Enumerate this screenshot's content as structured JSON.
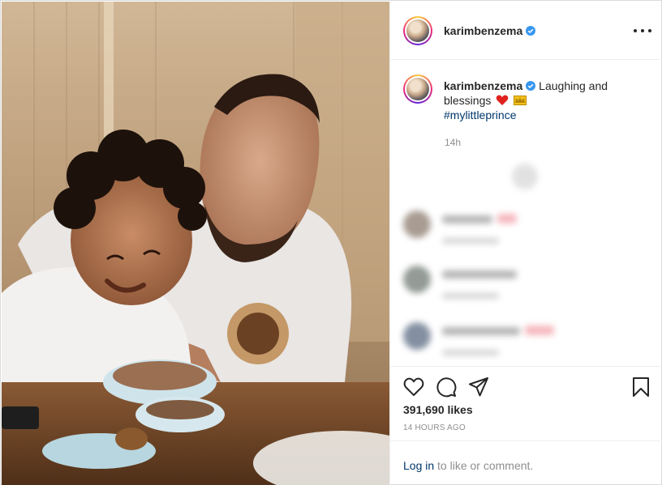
{
  "post": {
    "username": "karimbenzema",
    "caption_text": "Laughing and blessings",
    "hashtag": "#mylittleprince",
    "caption_time": "14h",
    "likes": "391,690 likes",
    "time_ago": "14 HOURS AGO"
  },
  "login": {
    "link_label": "Log in",
    "suffix": "to like or comment."
  },
  "icons": {
    "verified": "verified-badge-icon",
    "more": "more-options-icon",
    "like": "heart-outline-icon",
    "comment": "comment-bubble-icon",
    "share": "paper-plane-icon",
    "save": "bookmark-icon",
    "caption_emoji_1": "red-heart-emoji",
    "caption_emoji_2": "crown-emoji"
  },
  "colors": {
    "verified": "#3897f0",
    "link": "#00376b",
    "muted": "#8e8e8e",
    "text": "#262626"
  }
}
